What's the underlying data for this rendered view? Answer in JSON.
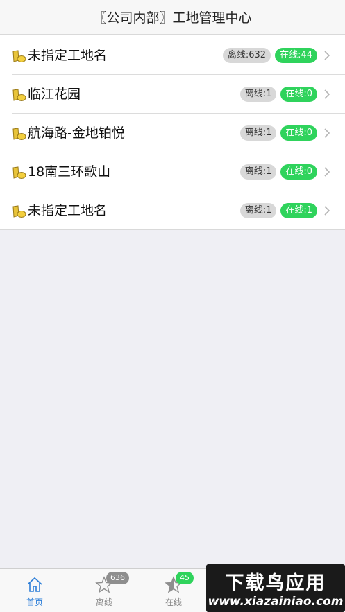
{
  "header": {
    "title": "〖公司内部〗工地管理中心"
  },
  "sites": [
    {
      "name": "未指定工地名",
      "offline": "离线:632",
      "online": "在线:44"
    },
    {
      "name": "临江花园",
      "offline": "离线:1",
      "online": "在线:0"
    },
    {
      "name": "航海路-金地铂悦",
      "offline": "离线:1",
      "online": "在线:0"
    },
    {
      "name": "18南三环歌山",
      "offline": "离线:1",
      "online": "在线:0"
    },
    {
      "name": "未指定工地名",
      "offline": "离线:1",
      "online": "在线:1"
    }
  ],
  "tabs": [
    {
      "label": "首页",
      "icon": "home-icon",
      "badge": ""
    },
    {
      "label": "离线",
      "icon": "star-outline-icon",
      "badge": "636"
    },
    {
      "label": "在线",
      "icon": "star-half-icon",
      "badge": "45"
    }
  ],
  "watermark": {
    "title": "下载鸟应用",
    "url": "www.xiazainiao.com"
  },
  "colors": {
    "accent": "#2e7fd8",
    "online": "#2fd35c",
    "offline_badge": "#d8d8d8",
    "background": "#efeff4"
  }
}
